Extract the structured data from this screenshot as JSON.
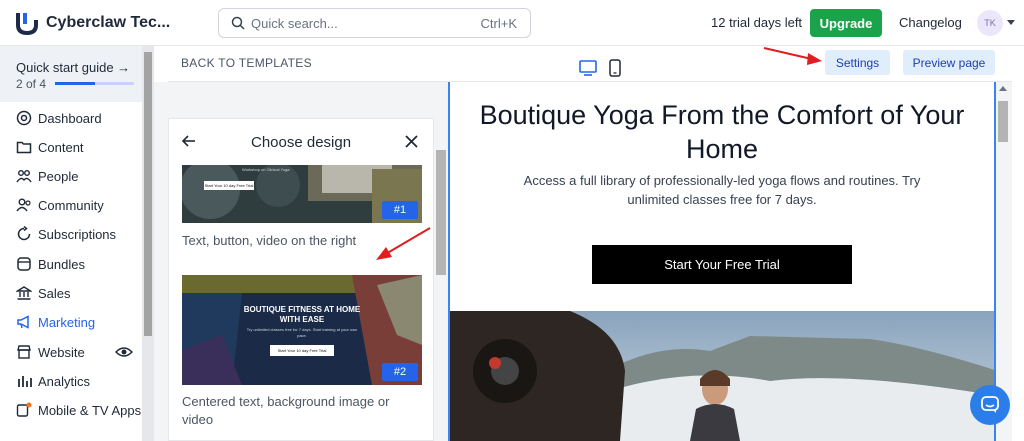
{
  "header": {
    "brand": "Cyberclaw Tec...",
    "search": {
      "placeholder": "Quick search...",
      "shortcut": "Ctrl+K"
    },
    "trial_text": "12 trial days left",
    "upgrade_label": "Upgrade",
    "changelog_label": "Changelog",
    "avatar_initials": "TK"
  },
  "sidebar": {
    "quick_start": {
      "title": "Quick start guide →",
      "step": "2 of 4",
      "progress": 0.5
    },
    "items": [
      {
        "label": "Dashboard",
        "icon": "dashboard-icon"
      },
      {
        "label": "Content",
        "icon": "folder-icon"
      },
      {
        "label": "People",
        "icon": "people-icon"
      },
      {
        "label": "Community",
        "icon": "community-icon"
      },
      {
        "label": "Subscriptions",
        "icon": "subscriptions-icon"
      },
      {
        "label": "Bundles",
        "icon": "bundles-icon"
      },
      {
        "label": "Sales",
        "icon": "sales-icon"
      },
      {
        "label": "Marketing",
        "icon": "marketing-icon",
        "active": true
      },
      {
        "label": "Website",
        "icon": "website-icon"
      },
      {
        "label": "Analytics",
        "icon": "analytics-icon"
      },
      {
        "label": "Mobile & TV Apps",
        "icon": "mobile-icon"
      }
    ]
  },
  "toolbar": {
    "back_label": "BACK TO TEMPLATES",
    "settings_label": "Settings",
    "preview_label": "Preview page"
  },
  "design_panel": {
    "title": "Choose design",
    "templates": [
      {
        "badge": "#1",
        "caption": "Text, button, video on the right",
        "thumb_button": "Start Your 10 day Free Trial",
        "thumb_text": "Workshop on Clinical Yoga"
      },
      {
        "badge": "#2",
        "caption": "Centered text, background image or video",
        "thumb_title": "BOUTIQUE FITNESS AT HOME WITH EASE",
        "thumb_text": "Try unlimited classes free for 7 days. Start training at your own pace.",
        "thumb_button": "Start Your 10 day Free Trial"
      }
    ]
  },
  "preview": {
    "title": "Boutique Yoga From the Comfort of Your Home",
    "subtitle": "Access a full library of professionally-led yoga flows and routines. Try unlimited classes free for 7 days.",
    "cta": "Start Your Free Trial"
  },
  "colors": {
    "accent": "#2563eb",
    "upgrade": "#1aa34a",
    "annotation_arrow": "#e11d1d"
  }
}
